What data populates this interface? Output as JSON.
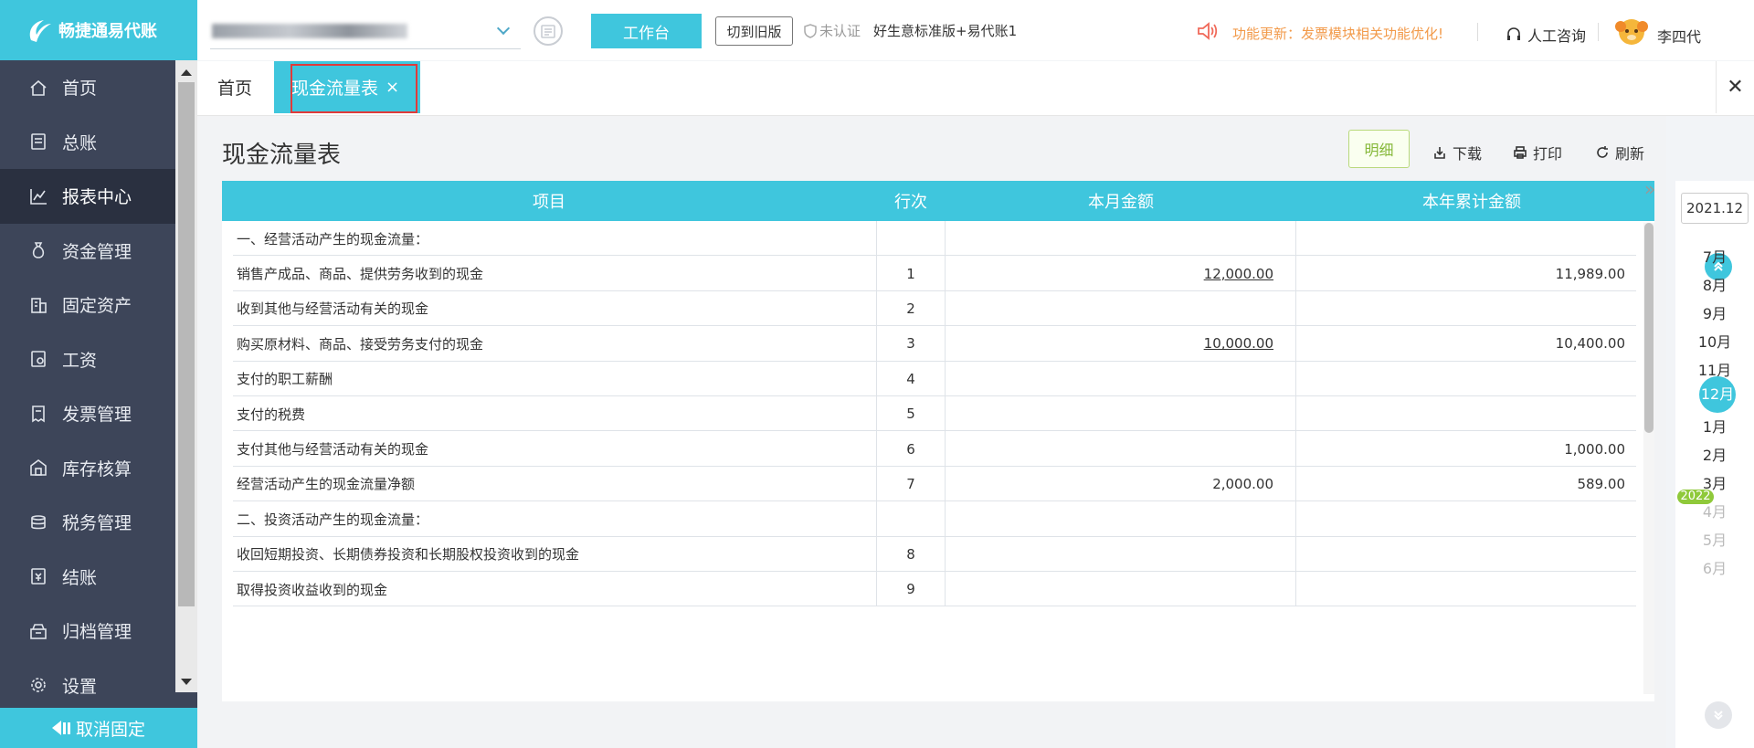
{
  "app": {
    "logo_text": "畅捷通易代账"
  },
  "sidebar": {
    "items": [
      {
        "label": "首页",
        "icon": "home-icon"
      },
      {
        "label": "总账",
        "icon": "ledger-icon"
      },
      {
        "label": "报表中心",
        "icon": "chart-icon"
      },
      {
        "label": "资金管理",
        "icon": "money-bag-icon"
      },
      {
        "label": "固定资产",
        "icon": "building-icon"
      },
      {
        "label": "工资",
        "icon": "salary-icon"
      },
      {
        "label": "发票管理",
        "icon": "invoice-icon"
      },
      {
        "label": "库存核算",
        "icon": "warehouse-icon"
      },
      {
        "label": "税务管理",
        "icon": "tax-icon"
      },
      {
        "label": "结账",
        "icon": "checkout-icon"
      },
      {
        "label": "归档管理",
        "icon": "archive-icon"
      },
      {
        "label": "设置",
        "icon": "gear-icon"
      }
    ],
    "active_index": 2,
    "unpin_label": "取消固定"
  },
  "header": {
    "workbench_label": "工作台",
    "old_version_label": "切到旧版",
    "auth_status": "未认证",
    "plan_name": "好生意标准版+易代账1",
    "notice": "功能更新：发票模块相关功能优化!",
    "consult_label": "人工咨询",
    "username": "李四代"
  },
  "tabs": {
    "home_label": "首页",
    "active_label": "现金流量表",
    "close_symbol": "×",
    "close_all_symbol": "✕"
  },
  "report": {
    "title": "现金流量表",
    "detail_label": "明细",
    "download_label": "下载",
    "print_label": "打印",
    "refresh_label": "刷新",
    "columns": {
      "item": "项目",
      "line": "行次",
      "month": "本月金额",
      "year": "本年累计金额"
    },
    "rows": [
      {
        "item": "一、经营活动产生的现金流量：",
        "line": "",
        "month": "",
        "year": ""
      },
      {
        "item": "销售产成品、商品、提供劳务收到的现金",
        "line": "1",
        "month": "12,000.00",
        "year": "11,989.00",
        "month_link": true
      },
      {
        "item": "收到其他与经营活动有关的现金",
        "line": "2",
        "month": "",
        "year": ""
      },
      {
        "item": "购买原材料、商品、接受劳务支付的现金",
        "line": "3",
        "month": "10,000.00",
        "year": "10,400.00",
        "month_link": true
      },
      {
        "item": "支付的职工薪酬",
        "line": "4",
        "month": "",
        "year": ""
      },
      {
        "item": "支付的税费",
        "line": "5",
        "month": "",
        "year": ""
      },
      {
        "item": "支付其他与经营活动有关的现金",
        "line": "6",
        "month": "",
        "year": "1,000.00"
      },
      {
        "item": "经营活动产生的现金流量净额",
        "line": "7",
        "month": "2,000.00",
        "year": "589.00"
      },
      {
        "item": "二、投资活动产生的现金流量：",
        "line": "",
        "month": "",
        "year": ""
      },
      {
        "item": "收回短期投资、长期债券投资和长期股权投资收到的现金",
        "line": "8",
        "month": "",
        "year": ""
      },
      {
        "item": "取得投资收益收到的现金",
        "line": "9",
        "month": "",
        "year": ""
      }
    ]
  },
  "period": {
    "current": "2021.12",
    "months": [
      {
        "label": "7月",
        "state": "normal"
      },
      {
        "label": "8月",
        "state": "normal"
      },
      {
        "label": "9月",
        "state": "normal"
      },
      {
        "label": "10月",
        "state": "normal"
      },
      {
        "label": "11月",
        "state": "normal"
      },
      {
        "label": "12月",
        "state": "active"
      },
      {
        "label": "1月",
        "state": "normal"
      },
      {
        "label": "2月",
        "state": "normal"
      },
      {
        "label": "3月",
        "state": "normal"
      },
      {
        "label": "4月",
        "state": "disabled"
      },
      {
        "label": "5月",
        "state": "disabled"
      },
      {
        "label": "6月",
        "state": "disabled"
      }
    ],
    "year_badge": "2022"
  },
  "colors": {
    "accent": "#3fc6dd",
    "sidebar": "#3d4559",
    "notice": "#f29a4a",
    "detail": "#86b83a"
  }
}
